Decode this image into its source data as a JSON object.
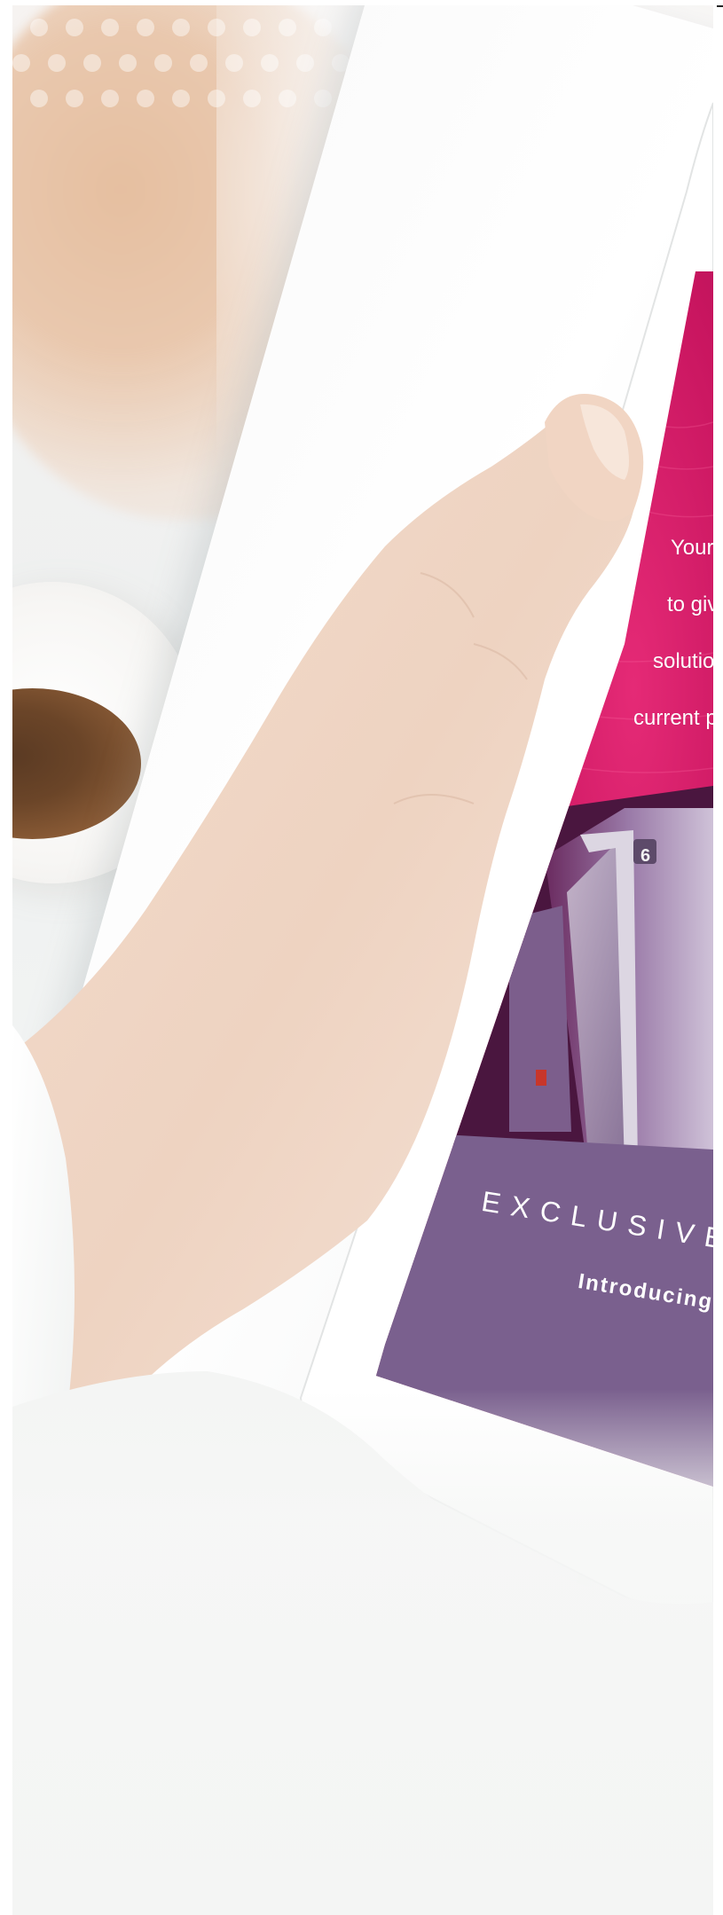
{
  "photo": {
    "subject": "hand-holding-tablet",
    "tablet_screen": {
      "copy_lines": [
        "Your",
        "to giv",
        "solutio",
        "current p"
      ],
      "safe_number": "6",
      "headline": "EXCLUSIVE T",
      "subline": "Introducing"
    }
  },
  "colors": {
    "screen_pink": "#c8155f",
    "screen_purple": "#7a608e",
    "skin": "#f0d6c6",
    "coffee": "#6b4528"
  },
  "icons": {
    "dots_pattern": "dot-grid-icon"
  }
}
